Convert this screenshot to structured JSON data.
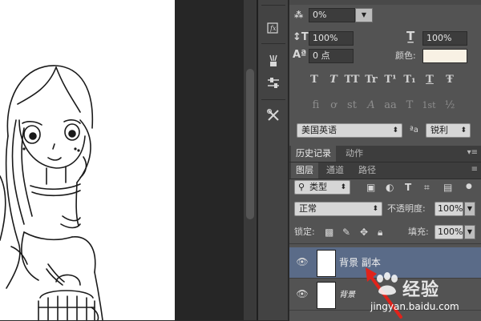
{
  "character_panel": {
    "tracking_value": "0%",
    "vertical_scale": "100%",
    "horizontal_scale": "100%",
    "baseline_shift": "0 点",
    "color_label": "颜色:",
    "color_swatch": "#f8f1e4",
    "style_buttons": [
      "T",
      "T",
      "TT",
      "Tr",
      "T¹",
      "T₁",
      "T",
      "Ŧ"
    ],
    "opentype_buttons": [
      "fi",
      "ơ",
      "st",
      "A",
      "aa",
      "T",
      "1st",
      "½"
    ],
    "language": "美国英语",
    "aa_label": "ªa",
    "antialias": "锐利"
  },
  "history_tabs": [
    "历史记录",
    "动作"
  ],
  "layers_tabs": [
    "图层",
    "通道",
    "路径"
  ],
  "layers_panel": {
    "filter_type": "类型",
    "blend_mode": "正常",
    "opacity_label": "不透明度:",
    "opacity_value": "100%",
    "lock_label": "锁定:",
    "fill_label": "填充:",
    "fill_value": "100%",
    "layers": [
      {
        "name": "背景 副本",
        "selected": true
      },
      {
        "name": "背景",
        "selected": false
      }
    ]
  },
  "watermark": {
    "brand": "经验",
    "url": "jingyan.baidu.com"
  },
  "colors": {
    "selected_layer": "#5a6b88",
    "arrow": "#e0231b"
  },
  "tool_icons": [
    "fx-icon",
    "brush-presets-icon",
    "adjustments-icon",
    "tools-icon"
  ]
}
